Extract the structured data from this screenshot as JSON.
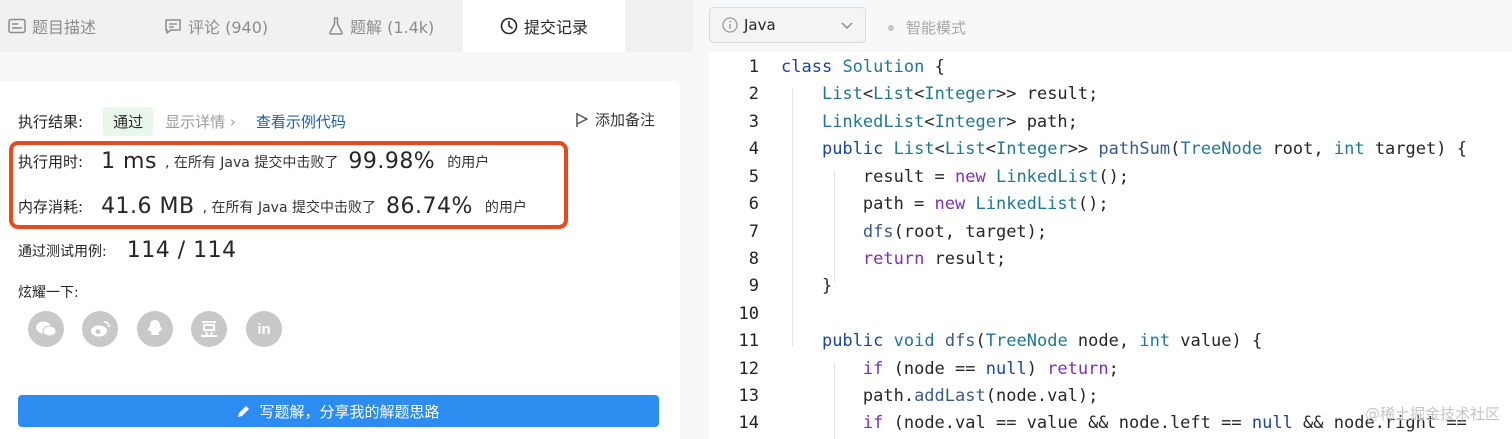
{
  "tabs": [
    {
      "label": "题目描述",
      "icon": "description-icon"
    },
    {
      "label": "评论 (940)",
      "icon": "comment-icon"
    },
    {
      "label": "题解 (1.4k)",
      "icon": "flask-icon"
    },
    {
      "label": "提交记录",
      "icon": "clock-icon",
      "active": true
    }
  ],
  "result": {
    "label": "执行结果:",
    "status": "通过",
    "details": "显示详情 ›",
    "example_link": "查看示例代码",
    "add_note": "添加备注"
  },
  "runtime": {
    "label": "执行用时:",
    "value": "1 ms",
    "text": ", 在所有 Java 提交中击败了",
    "percent": "99.98%",
    "suffix": "的用户"
  },
  "memory": {
    "label": "内存消耗:",
    "value": "41.6 MB",
    "text": ", 在所有 Java 提交中击败了",
    "percent": "86.74%",
    "suffix": "的用户"
  },
  "tests": {
    "label": "通过测试用例:",
    "value": "114 / 114"
  },
  "share": {
    "label": "炫耀一下:",
    "icons": [
      "wechat-icon",
      "weibo-icon",
      "qq-icon",
      "douban-icon",
      "linkedin-icon"
    ],
    "button": "写题解，分享我的解题思路"
  },
  "editor": {
    "language": "Java",
    "mode": "智能模式",
    "line_numbers": [
      "1",
      "2",
      "3",
      "4",
      "5",
      "6",
      "7",
      "8",
      "9",
      "10",
      "11",
      "12",
      "13",
      "14"
    ]
  },
  "watermark": "@稀土掘金技术社区",
  "colors": {
    "accent": "#2d8cf0",
    "highlight_border": "#e8491d",
    "pass_bg": "#e8f6ec",
    "link": "#1d5fb5"
  }
}
